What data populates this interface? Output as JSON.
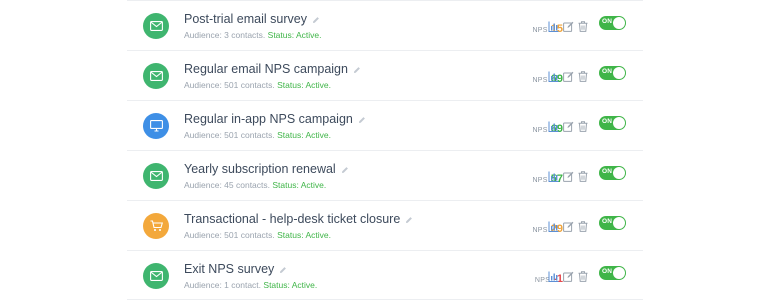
{
  "campaigns": [
    {
      "name": "Post-trial email survey",
      "audience": "Audience: 3 contacts.",
      "status": "Status: Active.",
      "nps_label": "NPS",
      "nps": "15",
      "nps_color": "#f0a43a",
      "icon": "envelope-icon",
      "icon_bg": "#3fb56f",
      "toggle": "ON"
    },
    {
      "name": "Regular email NPS campaign",
      "audience": "Audience: 501 contacts.",
      "status": "Status: Active.",
      "nps_label": "NPS",
      "nps": "69",
      "nps_color": "#3fb548",
      "icon": "envelope-icon",
      "icon_bg": "#3fb56f",
      "toggle": "ON"
    },
    {
      "name": "Regular in-app NPS campaign",
      "audience": "Audience: 501 contacts.",
      "status": "Status: Active.",
      "nps_label": "NPS",
      "nps": "69",
      "nps_color": "#3fb548",
      "icon": "monitor-icon",
      "icon_bg": "#3e8fe6",
      "toggle": "ON"
    },
    {
      "name": "Yearly subscription renewal",
      "audience": "Audience: 45 contacts.",
      "status": "Status: Active.",
      "nps_label": "NPS",
      "nps": "57",
      "nps_color": "#3fb548",
      "icon": "envelope-icon",
      "icon_bg": "#3fb56f",
      "toggle": "ON"
    },
    {
      "name": "Transactional - help-desk ticket closure",
      "audience": "Audience: 501 contacts.",
      "status": "Status: Active.",
      "nps_label": "NPS",
      "nps": "29",
      "nps_color": "#f0a43a",
      "icon": "cart-icon",
      "icon_bg": "#f3a83b",
      "toggle": "ON"
    },
    {
      "name": "Exit NPS survey",
      "audience": "Audience: 1 contact.",
      "status": "Status: Active.",
      "nps_label": "NPS",
      "nps": "-1",
      "nps_color": "#e5484d",
      "icon": "envelope-icon",
      "icon_bg": "#3fb56f",
      "toggle": "ON"
    }
  ]
}
